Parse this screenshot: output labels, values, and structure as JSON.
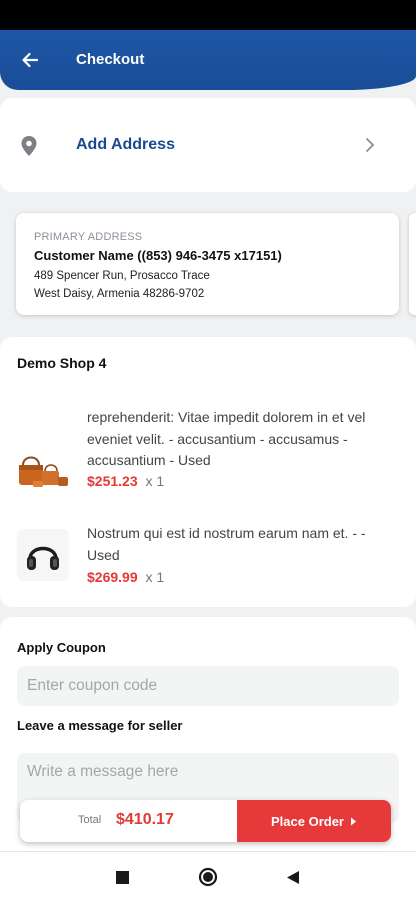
{
  "header": {
    "title": "Checkout",
    "back_icon": "arrow-left-icon"
  },
  "address": {
    "add_label": "Add Address",
    "pin_icon": "location-pin-icon",
    "chevron_icon": "chevron-right-icon"
  },
  "primary_address": {
    "label": "PRIMARY ADDRESS",
    "name_line": "Customer Name ((853) 946-3475 x17151)",
    "line1": "489 Spencer Run, Prosacco Trace",
    "line2": "West Daisy, Armenia 48286-9702"
  },
  "shop": {
    "name": "Demo Shop 4",
    "items": [
      {
        "description": "reprehenderit: Vitae impedit dolorem in et vel eveniet velit. - accusantium - accusamus - accusantium - Used",
        "price": "$251.23",
        "qty": "x 1",
        "thumb_icon": "handbag-set-icon"
      },
      {
        "description": "Nostrum qui est id nostrum earum nam et. - - Used",
        "price": "$269.99",
        "qty": "x 1",
        "thumb_icon": "headphones-icon"
      }
    ]
  },
  "coupon": {
    "label": "Apply Coupon",
    "placeholder": "Enter coupon code"
  },
  "message": {
    "label": "Leave a message for seller",
    "placeholder": "Write a message here"
  },
  "order": {
    "total_label": "Total",
    "total_value": "$410.17",
    "button_label": "Place Order",
    "button_icon": "caret-right-icon"
  },
  "colors": {
    "primary": "#1d57a8",
    "accent": "#e53935",
    "place_order_bg": "#e63a3a"
  },
  "navbar": {
    "icons": [
      "square-recents-icon",
      "circle-home-icon",
      "triangle-back-icon"
    ]
  }
}
